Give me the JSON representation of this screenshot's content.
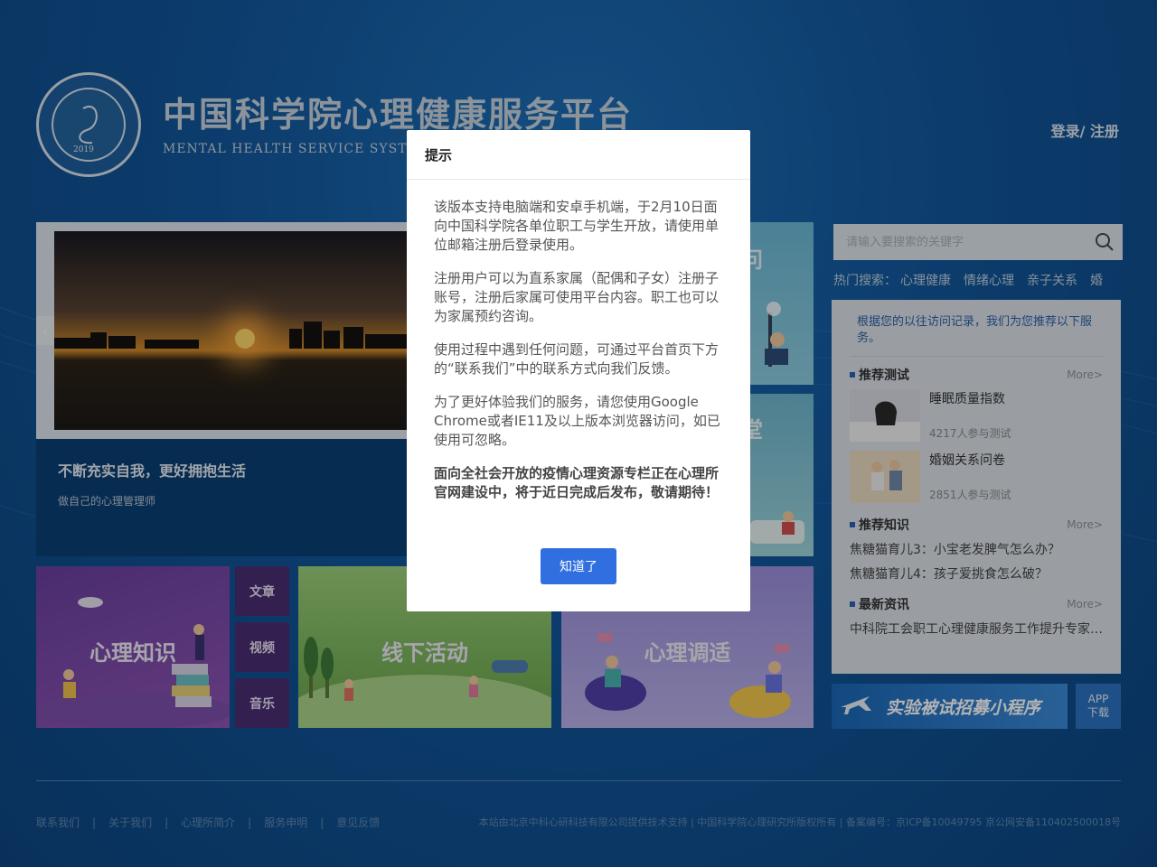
{
  "header": {
    "title": "中国科学院心理健康服务平台",
    "subtitle": "MENTAL HEALTH SERVICE SYSTEM",
    "seal_year": "2019",
    "auth": {
      "login": "登录/",
      "register": " 注册"
    }
  },
  "banner": {
    "caption_title": "不断充实自我，更好拥抱生活",
    "caption_sub": "做自己的心理管理师",
    "prev_icon": "chevron-left-icon"
  },
  "tiles": {
    "top_right_partial": "问",
    "mid_right_partial": "堂",
    "knowledge": "心理知识",
    "side_buttons": [
      "文章",
      "视频",
      "音乐"
    ],
    "offline": "线下活动",
    "adjust": "心理调适"
  },
  "search": {
    "placeholder": "请输入要搜索的关键字",
    "icon": "search-icon"
  },
  "hot_search": {
    "label": "热门搜索：",
    "terms": [
      "心理健康",
      "情绪心理",
      "亲子关系",
      "婚"
    ]
  },
  "recommend": {
    "note": "根据您的以往访问记录，我们为您推荐以下服务。",
    "tests_heading": "推荐测试",
    "more": "More>",
    "tests": [
      {
        "title": "睡眠质量指数",
        "count": "4217人参与测试"
      },
      {
        "title": "婚姻关系问卷",
        "count": "2851人参与测试"
      }
    ],
    "knowledge_heading": "推荐知识",
    "knowledge": [
      "焦糖猫育儿3：小宝老发脾气怎么办？",
      "焦糖猫育儿4：孩子爱挑食怎么破？"
    ],
    "news_heading": "最新资讯",
    "news": [
      "中科院工会职工心理健康服务工作提升专家…"
    ]
  },
  "mini_program": {
    "label": "实验被试招募小程序"
  },
  "app_download": {
    "line1": "APP",
    "line2": "下载"
  },
  "footer": {
    "links": [
      "联系我们",
      "关于我们",
      "心理所简介",
      "服务申明",
      "意见反馈"
    ],
    "separator": "|",
    "copyright": "本站由北京中科心研科技有限公司提供技术支持 | 中国科学院心理研究所版权所有 | 备案编号：京ICP备10049795 京公网安备110402500018号"
  },
  "modal": {
    "title": "提示",
    "paragraphs": [
      "该版本支持电脑端和安卓手机端，于2月10日面向中国科学院各单位职工与学生开放，请使用单位邮箱注册后登录使用。",
      "注册用户可以为直系家属（配偶和子女）注册子账号，注册后家属可使用平台内容。职工也可以为家属预约咨询。",
      "使用过程中遇到任何问题，可通过平台首页下方的“联系我们”中的联系方式向我们反馈。",
      "为了更好体验我们的服务，请您使用Google Chrome或者IE11及以上版本浏览器访问，如已使用可忽略。"
    ],
    "bold_paragraph": "面向全社会开放的疫情心理资源专栏正在心理所官网建设中，将于近日完成后发布，敬请期待！",
    "ok_button": "知道了"
  },
  "colors": {
    "background": "#12579c",
    "primary_button": "#2f6fe0",
    "link_blue": "#2b5fa6"
  }
}
